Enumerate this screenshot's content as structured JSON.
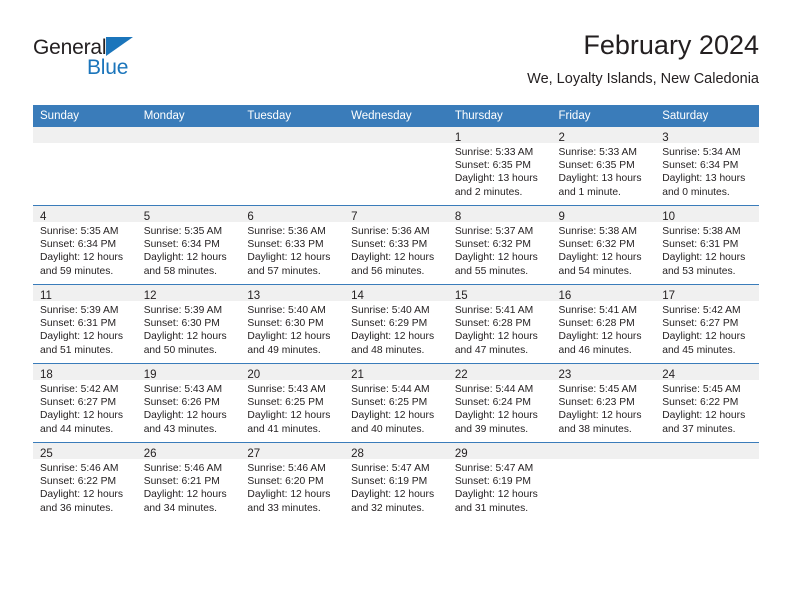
{
  "brand": {
    "name_part1": "General",
    "name_part2": "Blue",
    "accent_color": "#1b75bb"
  },
  "header": {
    "month_title": "February 2024",
    "location": "We, Loyalty Islands, New Caledonia"
  },
  "theme": {
    "header_blue": "#3a7cba",
    "daynum_band": "#f0f0f0",
    "text": "#231f20"
  },
  "weekday_headers": [
    "Sunday",
    "Monday",
    "Tuesday",
    "Wednesday",
    "Thursday",
    "Friday",
    "Saturday"
  ],
  "labels": {
    "sunrise_prefix": "Sunrise:",
    "sunset_prefix": "Sunset:",
    "daylight_prefix": "Daylight:"
  },
  "weeks": [
    [
      {
        "day": "",
        "empty": true
      },
      {
        "day": "",
        "empty": true
      },
      {
        "day": "",
        "empty": true
      },
      {
        "day": "",
        "empty": true
      },
      {
        "day": "1",
        "sunrise": "Sunrise: 5:33 AM",
        "sunset": "Sunset: 6:35 PM",
        "daylight_line1": "Daylight: 13 hours",
        "daylight_line2": "and 2 minutes."
      },
      {
        "day": "2",
        "sunrise": "Sunrise: 5:33 AM",
        "sunset": "Sunset: 6:35 PM",
        "daylight_line1": "Daylight: 13 hours",
        "daylight_line2": "and 1 minute."
      },
      {
        "day": "3",
        "sunrise": "Sunrise: 5:34 AM",
        "sunset": "Sunset: 6:34 PM",
        "daylight_line1": "Daylight: 13 hours",
        "daylight_line2": "and 0 minutes."
      }
    ],
    [
      {
        "day": "4",
        "sunrise": "Sunrise: 5:35 AM",
        "sunset": "Sunset: 6:34 PM",
        "daylight_line1": "Daylight: 12 hours",
        "daylight_line2": "and 59 minutes."
      },
      {
        "day": "5",
        "sunrise": "Sunrise: 5:35 AM",
        "sunset": "Sunset: 6:34 PM",
        "daylight_line1": "Daylight: 12 hours",
        "daylight_line2": "and 58 minutes."
      },
      {
        "day": "6",
        "sunrise": "Sunrise: 5:36 AM",
        "sunset": "Sunset: 6:33 PM",
        "daylight_line1": "Daylight: 12 hours",
        "daylight_line2": "and 57 minutes."
      },
      {
        "day": "7",
        "sunrise": "Sunrise: 5:36 AM",
        "sunset": "Sunset: 6:33 PM",
        "daylight_line1": "Daylight: 12 hours",
        "daylight_line2": "and 56 minutes."
      },
      {
        "day": "8",
        "sunrise": "Sunrise: 5:37 AM",
        "sunset": "Sunset: 6:32 PM",
        "daylight_line1": "Daylight: 12 hours",
        "daylight_line2": "and 55 minutes."
      },
      {
        "day": "9",
        "sunrise": "Sunrise: 5:38 AM",
        "sunset": "Sunset: 6:32 PM",
        "daylight_line1": "Daylight: 12 hours",
        "daylight_line2": "and 54 minutes."
      },
      {
        "day": "10",
        "sunrise": "Sunrise: 5:38 AM",
        "sunset": "Sunset: 6:31 PM",
        "daylight_line1": "Daylight: 12 hours",
        "daylight_line2": "and 53 minutes."
      }
    ],
    [
      {
        "day": "11",
        "sunrise": "Sunrise: 5:39 AM",
        "sunset": "Sunset: 6:31 PM",
        "daylight_line1": "Daylight: 12 hours",
        "daylight_line2": "and 51 minutes."
      },
      {
        "day": "12",
        "sunrise": "Sunrise: 5:39 AM",
        "sunset": "Sunset: 6:30 PM",
        "daylight_line1": "Daylight: 12 hours",
        "daylight_line2": "and 50 minutes."
      },
      {
        "day": "13",
        "sunrise": "Sunrise: 5:40 AM",
        "sunset": "Sunset: 6:30 PM",
        "daylight_line1": "Daylight: 12 hours",
        "daylight_line2": "and 49 minutes."
      },
      {
        "day": "14",
        "sunrise": "Sunrise: 5:40 AM",
        "sunset": "Sunset: 6:29 PM",
        "daylight_line1": "Daylight: 12 hours",
        "daylight_line2": "and 48 minutes."
      },
      {
        "day": "15",
        "sunrise": "Sunrise: 5:41 AM",
        "sunset": "Sunset: 6:28 PM",
        "daylight_line1": "Daylight: 12 hours",
        "daylight_line2": "and 47 minutes."
      },
      {
        "day": "16",
        "sunrise": "Sunrise: 5:41 AM",
        "sunset": "Sunset: 6:28 PM",
        "daylight_line1": "Daylight: 12 hours",
        "daylight_line2": "and 46 minutes."
      },
      {
        "day": "17",
        "sunrise": "Sunrise: 5:42 AM",
        "sunset": "Sunset: 6:27 PM",
        "daylight_line1": "Daylight: 12 hours",
        "daylight_line2": "and 45 minutes."
      }
    ],
    [
      {
        "day": "18",
        "sunrise": "Sunrise: 5:42 AM",
        "sunset": "Sunset: 6:27 PM",
        "daylight_line1": "Daylight: 12 hours",
        "daylight_line2": "and 44 minutes."
      },
      {
        "day": "19",
        "sunrise": "Sunrise: 5:43 AM",
        "sunset": "Sunset: 6:26 PM",
        "daylight_line1": "Daylight: 12 hours",
        "daylight_line2": "and 43 minutes."
      },
      {
        "day": "20",
        "sunrise": "Sunrise: 5:43 AM",
        "sunset": "Sunset: 6:25 PM",
        "daylight_line1": "Daylight: 12 hours",
        "daylight_line2": "and 41 minutes."
      },
      {
        "day": "21",
        "sunrise": "Sunrise: 5:44 AM",
        "sunset": "Sunset: 6:25 PM",
        "daylight_line1": "Daylight: 12 hours",
        "daylight_line2": "and 40 minutes."
      },
      {
        "day": "22",
        "sunrise": "Sunrise: 5:44 AM",
        "sunset": "Sunset: 6:24 PM",
        "daylight_line1": "Daylight: 12 hours",
        "daylight_line2": "and 39 minutes."
      },
      {
        "day": "23",
        "sunrise": "Sunrise: 5:45 AM",
        "sunset": "Sunset: 6:23 PM",
        "daylight_line1": "Daylight: 12 hours",
        "daylight_line2": "and 38 minutes."
      },
      {
        "day": "24",
        "sunrise": "Sunrise: 5:45 AM",
        "sunset": "Sunset: 6:22 PM",
        "daylight_line1": "Daylight: 12 hours",
        "daylight_line2": "and 37 minutes."
      }
    ],
    [
      {
        "day": "25",
        "sunrise": "Sunrise: 5:46 AM",
        "sunset": "Sunset: 6:22 PM",
        "daylight_line1": "Daylight: 12 hours",
        "daylight_line2": "and 36 minutes."
      },
      {
        "day": "26",
        "sunrise": "Sunrise: 5:46 AM",
        "sunset": "Sunset: 6:21 PM",
        "daylight_line1": "Daylight: 12 hours",
        "daylight_line2": "and 34 minutes."
      },
      {
        "day": "27",
        "sunrise": "Sunrise: 5:46 AM",
        "sunset": "Sunset: 6:20 PM",
        "daylight_line1": "Daylight: 12 hours",
        "daylight_line2": "and 33 minutes."
      },
      {
        "day": "28",
        "sunrise": "Sunrise: 5:47 AM",
        "sunset": "Sunset: 6:19 PM",
        "daylight_line1": "Daylight: 12 hours",
        "daylight_line2": "and 32 minutes."
      },
      {
        "day": "29",
        "sunrise": "Sunrise: 5:47 AM",
        "sunset": "Sunset: 6:19 PM",
        "daylight_line1": "Daylight: 12 hours",
        "daylight_line2": "and 31 minutes."
      },
      {
        "day": "",
        "empty": true
      },
      {
        "day": "",
        "empty": true
      }
    ]
  ]
}
